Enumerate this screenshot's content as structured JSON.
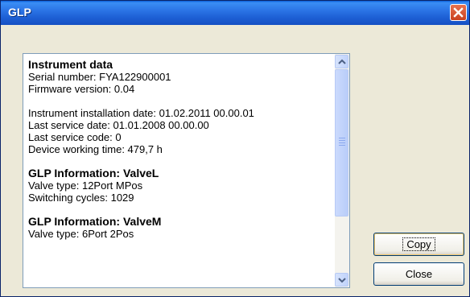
{
  "window": {
    "title": "GLP"
  },
  "info": {
    "lines": [
      {
        "text": "Instrument data",
        "bold": true
      },
      {
        "text": "Serial number: FYA122900001"
      },
      {
        "text": "Firmware version: 0.04"
      },
      {
        "text": ""
      },
      {
        "text": "Instrument installation date: 01.02.2011 00.00.01"
      },
      {
        "text": "Last service date: 01.01.2008 00.00.00"
      },
      {
        "text": "Last service code: 0"
      },
      {
        "text": "Device working time: 479,7 h"
      },
      {
        "text": ""
      },
      {
        "text": "GLP Information: ValveL",
        "bold": true
      },
      {
        "text": "Valve type: 12Port MPos"
      },
      {
        "text": "Switching cycles: 1029"
      },
      {
        "text": ""
      },
      {
        "text": "GLP Information: ValveM",
        "bold": true
      },
      {
        "text": "Valve type: 6Port 2Pos"
      }
    ]
  },
  "buttons": {
    "copy": "Copy",
    "close": "Close"
  }
}
